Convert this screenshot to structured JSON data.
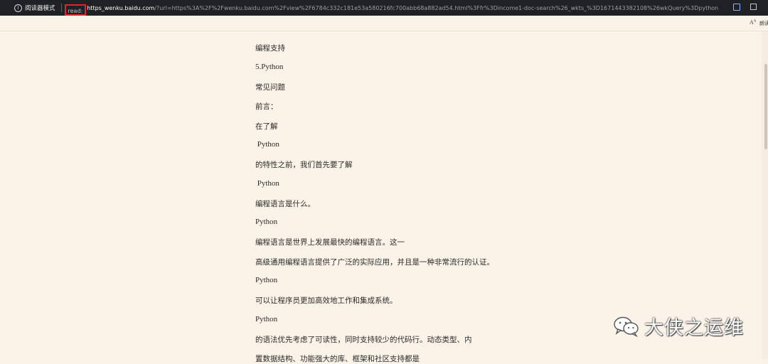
{
  "address_bar": {
    "reader_mode_label": "阅读器模式",
    "url_prefix": "read:",
    "url_host": "https_wenku.baidu.com",
    "url_rest": "/?url=https%3A%2F%2Fwenku.baidu.com%2Fview%2F6784c332c181e53a580216fc700abb68a882ad54.html%3Ffr%3Dincome1-doc-search%26_wkts_%3D1671443382108%26wkQuery%3Dpython"
  },
  "toolbar": {
    "text_prefs_label": "朗读"
  },
  "article": {
    "paragraphs": [
      "编程支持",
      "5.Python",
      "常见问题",
      "前言：",
      "在了解",
      " Python",
      "的特性之前，我们首先要了解",
      " Python",
      "编程语言是什么。",
      "Python",
      "编程语言是世界上发展最快的编程语言。这一",
      "高级通用编程语言提供了广泛的实际应用，并且是一种非常流行的认证。",
      "Python",
      "可以让程序员更加高效地工作和集成系统。",
      "Python",
      "的语法优先考虑了可读性，同时支持较少的代码行。动态类型、内",
      "置数据结构、功能强大的库、框架和社区支持都是"
    ]
  },
  "watermark": {
    "text": "大侠之运维",
    "icon": "wechat-icon"
  },
  "colors": {
    "page_bg": "#fbf2e8",
    "addr_bg": "#202124",
    "highlight_box": "#e02626"
  }
}
